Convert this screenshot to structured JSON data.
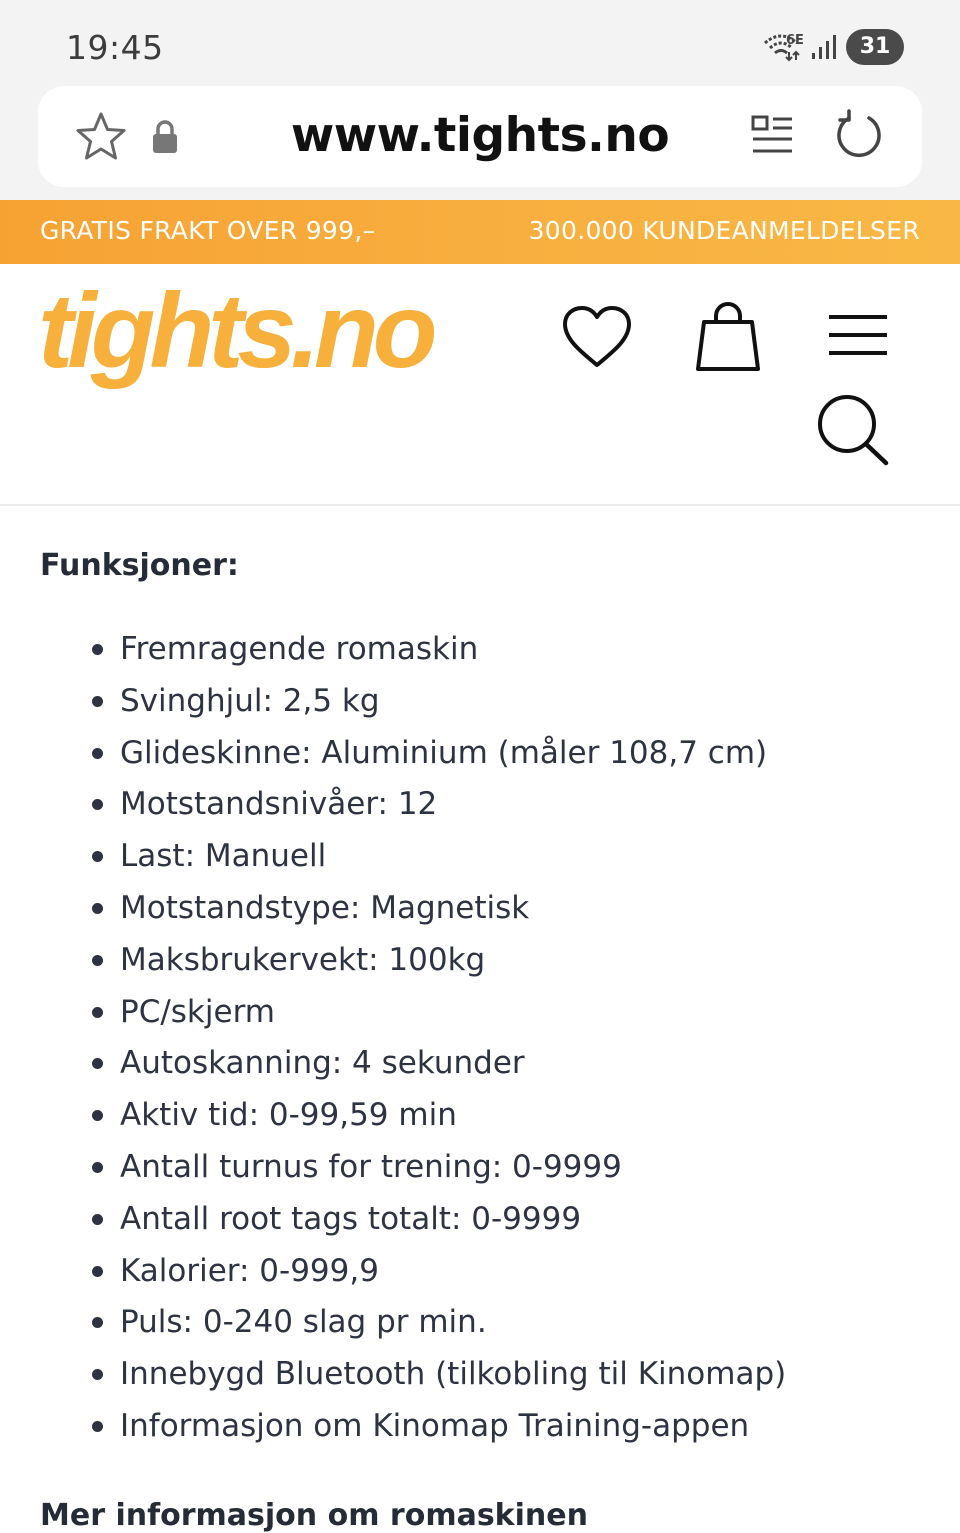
{
  "status_bar": {
    "time": "19:45",
    "battery": "31",
    "icons": [
      "wifi-6e-icon",
      "signal-icon",
      "battery-icon"
    ]
  },
  "browser": {
    "url": "www.tights.no",
    "icons": [
      "star-icon",
      "lock-icon",
      "reader-mode-icon",
      "reload-icon"
    ]
  },
  "promo": {
    "left": "GRATIS FRAKT OVER 999,–",
    "right": "300.000 KUNDEANMELDELSER",
    "color": "#f7a838"
  },
  "header": {
    "logo": "tights.no",
    "logo_color": "#f7b03c",
    "icons": [
      "heart-icon",
      "bag-icon",
      "menu-icon",
      "search-icon"
    ]
  },
  "main": {
    "section_title": "Funksjoner:",
    "features": [
      "Fremragende romaskin",
      "Svinghjul: 2,5 kg",
      "Glideskinne: Aluminium (måler 108,7 cm)",
      "Motstandsnivåer: 12",
      "Last: Manuell",
      "Motstandstype: Magnetisk",
      "Maksbrukervekt: 100kg",
      "PC/skjerm",
      "Autoskanning: 4 sekunder",
      "Aktiv tid: 0-99,59 min",
      "Antall turnus for trening: 0-9999",
      "Antall root tags totalt: 0-9999",
      "Kalorier: 0-999,9",
      "Puls: 0-240 slag pr min.",
      "Innebygd Bluetooth (tilkobling til Kinomap)",
      "Informasjon om Kinomap Training-appen"
    ],
    "next_section_title": "Mer informasjon om romaskinen"
  }
}
